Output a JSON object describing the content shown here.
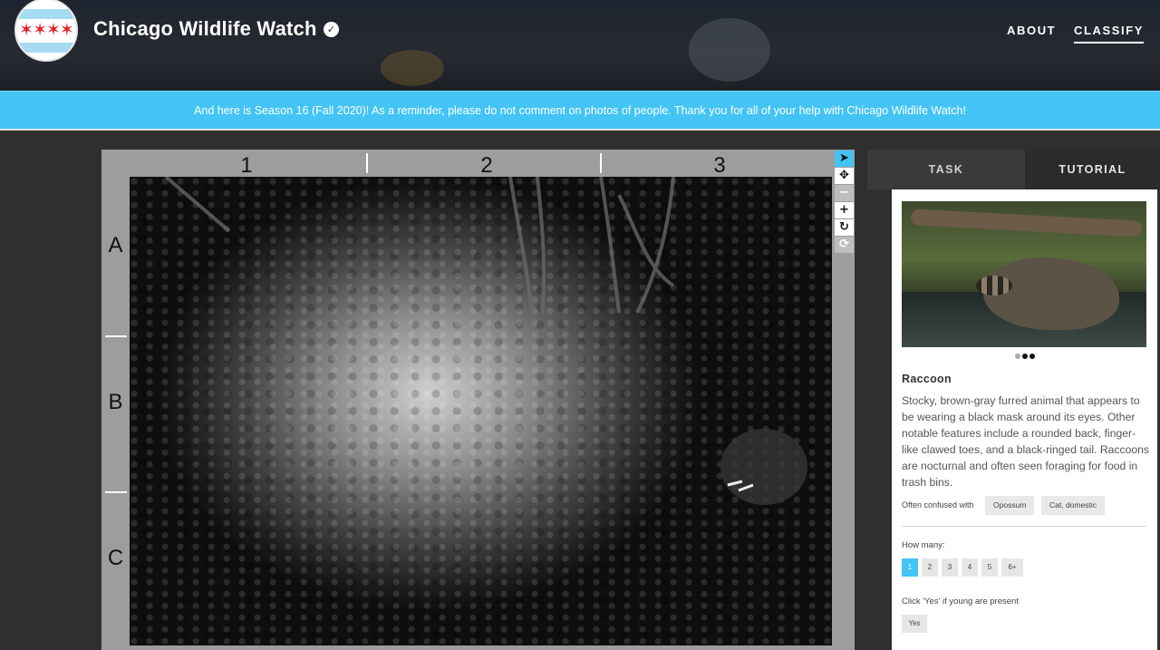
{
  "header": {
    "title": "Chicago Wildlife Watch",
    "nav": [
      "ABOUT",
      "CLASSIFY"
    ]
  },
  "banner": {
    "text": "And here is Season 16 (Fall 2020)! As a reminder, please do not comment on photos of people. Thank you for all of your help with Chicago Wildlife Watch!"
  },
  "viewer": {
    "columns": [
      "1",
      "2",
      "3"
    ],
    "rows": [
      "A",
      "B",
      "C"
    ],
    "tools": [
      "pointer-icon",
      "pan-icon",
      "zoom-out-icon",
      "zoom-in-icon",
      "rotate-icon",
      "reset-icon"
    ]
  },
  "panel": {
    "tabs": [
      "TASK",
      "TUTORIAL"
    ],
    "species_name": "Raccoon",
    "description": "Stocky, brown-gray furred animal that appears to be wearing a black mask around its eyes. Other notable features include a rounded back, finger-like clawed toes, and a black-ringed tail. Raccoons are nocturnal and often seen foraging for food in trash bins.",
    "confused_label": "Often confused with",
    "confused_with": [
      "Opossum",
      "Cat, domestic"
    ],
    "how_many_label": "How many:",
    "how_many_options": [
      "1",
      "2",
      "3",
      "4",
      "5",
      "6+"
    ],
    "selected_count": "1",
    "young_label": "Click 'Yes' if young are present",
    "yes_label": "Yes"
  },
  "colors": {
    "accent": "#43c4f5",
    "header_bg": "#262a31",
    "page_bg": "#2f2f2f"
  }
}
